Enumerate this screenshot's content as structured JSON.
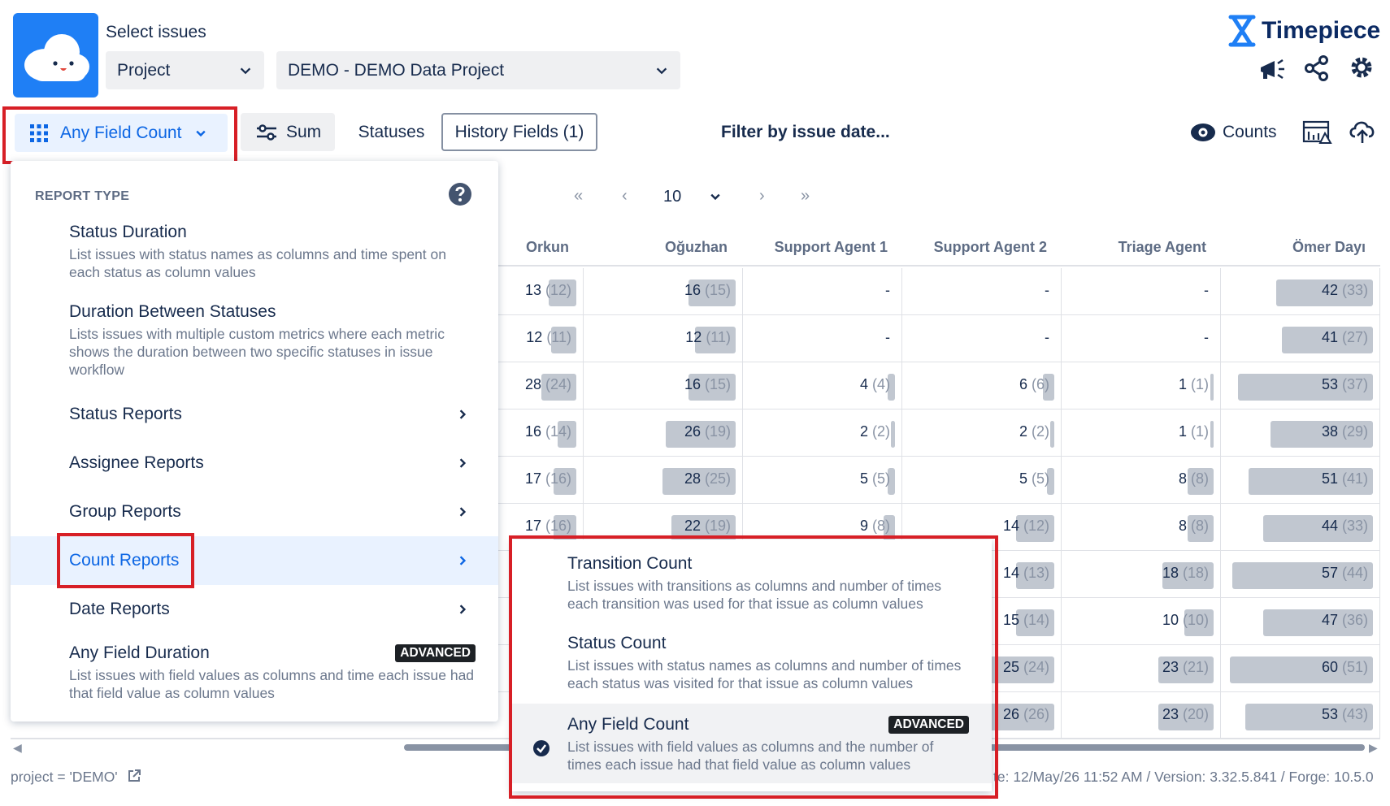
{
  "header": {
    "select_label": "Select issues",
    "scope_select": "Project",
    "project_select": "DEMO - DEMO Data Project",
    "brand": "Timepiece"
  },
  "toolbar": {
    "report_button": "Any Field Count",
    "sum_button": "Sum",
    "statuses_button": "Statuses",
    "history_fields_button": "History Fields (1)",
    "filter_date": "Filter by issue date...",
    "counts_button": "Counts"
  },
  "pagination": {
    "page_size": "10"
  },
  "report_menu": {
    "section_title": "REPORT TYPE",
    "items": [
      {
        "title": "Status Duration",
        "desc": "List issues with status names as columns and time spent on each status as column values"
      },
      {
        "title": "Duration Between Statuses",
        "desc": "Lists issues with multiple custom metrics where each metric shows the duration between two specific statuses in issue workflow"
      },
      {
        "title": "Status Reports"
      },
      {
        "title": "Assignee Reports"
      },
      {
        "title": "Group Reports"
      },
      {
        "title": "Count Reports"
      },
      {
        "title": "Date Reports"
      },
      {
        "title": "Any Field Duration",
        "badge": "ADVANCED",
        "desc": "List issues with field values as columns and time each issue had that field value as column values"
      }
    ]
  },
  "count_submenu": {
    "items": [
      {
        "title": "Transition Count",
        "desc": "List issues with transitions as columns and number of times each transition was used for that issue as column values"
      },
      {
        "title": "Status Count",
        "desc": "List issues with status names as columns and number of times each status was visited for that issue as column values"
      },
      {
        "title": "Any Field Count",
        "badge": "ADVANCED",
        "desc": "List issues with field values as columns and the number of times each issue had that field value as column values"
      }
    ]
  },
  "table": {
    "columns": [
      "Orkun",
      "Oğuzhan",
      "Support Agent 1",
      "Support Agent 2",
      "Triage Agent",
      "Ömer Dayı"
    ],
    "rows": [
      [
        "13 (12)",
        "16 (15)",
        "-",
        "-",
        "-",
        "42 (33)"
      ],
      [
        "12 (11)",
        "12 (11)",
        "-",
        "-",
        "-",
        "41 (27)"
      ],
      [
        "28 (24)",
        "16 (15)",
        "4 (4)",
        "6 (6)",
        "1 (1)",
        "53 (37)"
      ],
      [
        "16 (14)",
        "26 (19)",
        "2 (2)",
        "2 (2)",
        "1 (1)",
        "38 (29)"
      ],
      [
        "17 (16)",
        "28 (25)",
        "5 (5)",
        "5 (5)",
        "8 (8)",
        "51 (41)"
      ],
      [
        "17 (16)",
        "22 (19)",
        "9 (8)",
        "14 (12)",
        "8 (8)",
        "44 (33)"
      ],
      [
        "",
        "",
        "",
        "14 (13)",
        "18 (18)",
        "57 (44)"
      ],
      [
        "",
        "",
        "",
        "15 (14)",
        "10 (10)",
        "47 (36)"
      ],
      [
        "",
        "",
        "",
        "25 (24)",
        "23 (21)",
        "60 (51)"
      ],
      [
        "",
        "",
        "",
        "26 (26)",
        "23 (20)",
        "53 (43)"
      ]
    ],
    "bar_fractions": [
      [
        0.38,
        0.32,
        0,
        0,
        0,
        0.66
      ],
      [
        0.35,
        0.28,
        0,
        0,
        0,
        0.62
      ],
      [
        0.48,
        0.32,
        0.05,
        0.08,
        0.02,
        0.92
      ],
      [
        0.26,
        0.48,
        0.03,
        0.03,
        0.02,
        0.7
      ],
      [
        0.32,
        0.5,
        0.05,
        0.05,
        0.18,
        0.85
      ],
      [
        0.32,
        0.44,
        0.08,
        0.26,
        0.18,
        0.75
      ],
      [
        0,
        0,
        0,
        0.26,
        0.35,
        0.96
      ],
      [
        0,
        0,
        0,
        0.26,
        0.2,
        0.75
      ],
      [
        0,
        0,
        0,
        0.45,
        0.38,
        0.98
      ],
      [
        0,
        0,
        0,
        0.45,
        0.38,
        0.87
      ]
    ]
  },
  "footer": {
    "jql": "project = 'DEMO'",
    "status": "te: 12/May/26 11:52 AM / Version: 3.32.5.841 / Forge: 10.5.0"
  }
}
